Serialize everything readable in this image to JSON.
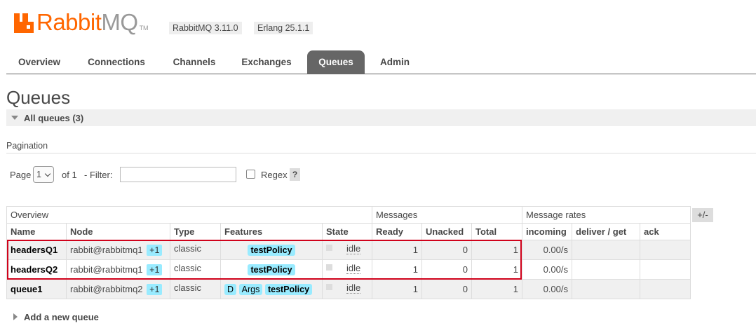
{
  "header": {
    "logo_rabbit": "Rabbit",
    "logo_mq": "MQ",
    "logo_tm": "TM",
    "version_label": "RabbitMQ 3.11.0",
    "erlang_label": "Erlang 25.1.1",
    "brand_color": "#ff6600"
  },
  "tabs": [
    {
      "label": "Overview",
      "active": false
    },
    {
      "label": "Connections",
      "active": false
    },
    {
      "label": "Channels",
      "active": false
    },
    {
      "label": "Exchanges",
      "active": false
    },
    {
      "label": "Queues",
      "active": true
    },
    {
      "label": "Admin",
      "active": false
    }
  ],
  "page_title": "Queues",
  "section": {
    "title": "All queues (3)"
  },
  "pagination": {
    "label": "Pagination",
    "page_label": "Page",
    "page_value": "1",
    "of_label": "of 1",
    "filter_label": "- Filter:",
    "filter_value": "",
    "regex_label": "Regex",
    "help_label": "?"
  },
  "table": {
    "groups": [
      "Overview",
      "Messages",
      "Message rates"
    ],
    "columns": [
      "Name",
      "Node",
      "Type",
      "Features",
      "State",
      "Ready",
      "Unacked",
      "Total",
      "incoming",
      "deliver / get",
      "ack"
    ],
    "toggle_label": "+/-",
    "rows": [
      {
        "name": "headersQ1",
        "node": "rabbit@rabbitmq1",
        "mirrors": "+1",
        "type": "classic",
        "features": [
          "testPolicy"
        ],
        "state": "idle",
        "ready": "1",
        "unacked": "0",
        "total": "1",
        "incoming": "0.00/s",
        "deliver": "",
        "ack": ""
      },
      {
        "name": "headersQ2",
        "node": "rabbit@rabbitmq1",
        "mirrors": "+1",
        "type": "classic",
        "features": [
          "testPolicy"
        ],
        "state": "idle",
        "ready": "1",
        "unacked": "0",
        "total": "1",
        "incoming": "0.00/s",
        "deliver": "",
        "ack": ""
      },
      {
        "name": "queue1",
        "node": "rabbit@rabbitmq2",
        "mirrors": "+1",
        "type": "classic",
        "features": [
          "D",
          "Args",
          "testPolicy"
        ],
        "state": "idle",
        "ready": "1",
        "unacked": "0",
        "total": "1",
        "incoming": "0.00/s",
        "deliver": "",
        "ack": ""
      }
    ]
  },
  "add_new_queue": "Add a new queue",
  "highlight_color": "#d0021b"
}
